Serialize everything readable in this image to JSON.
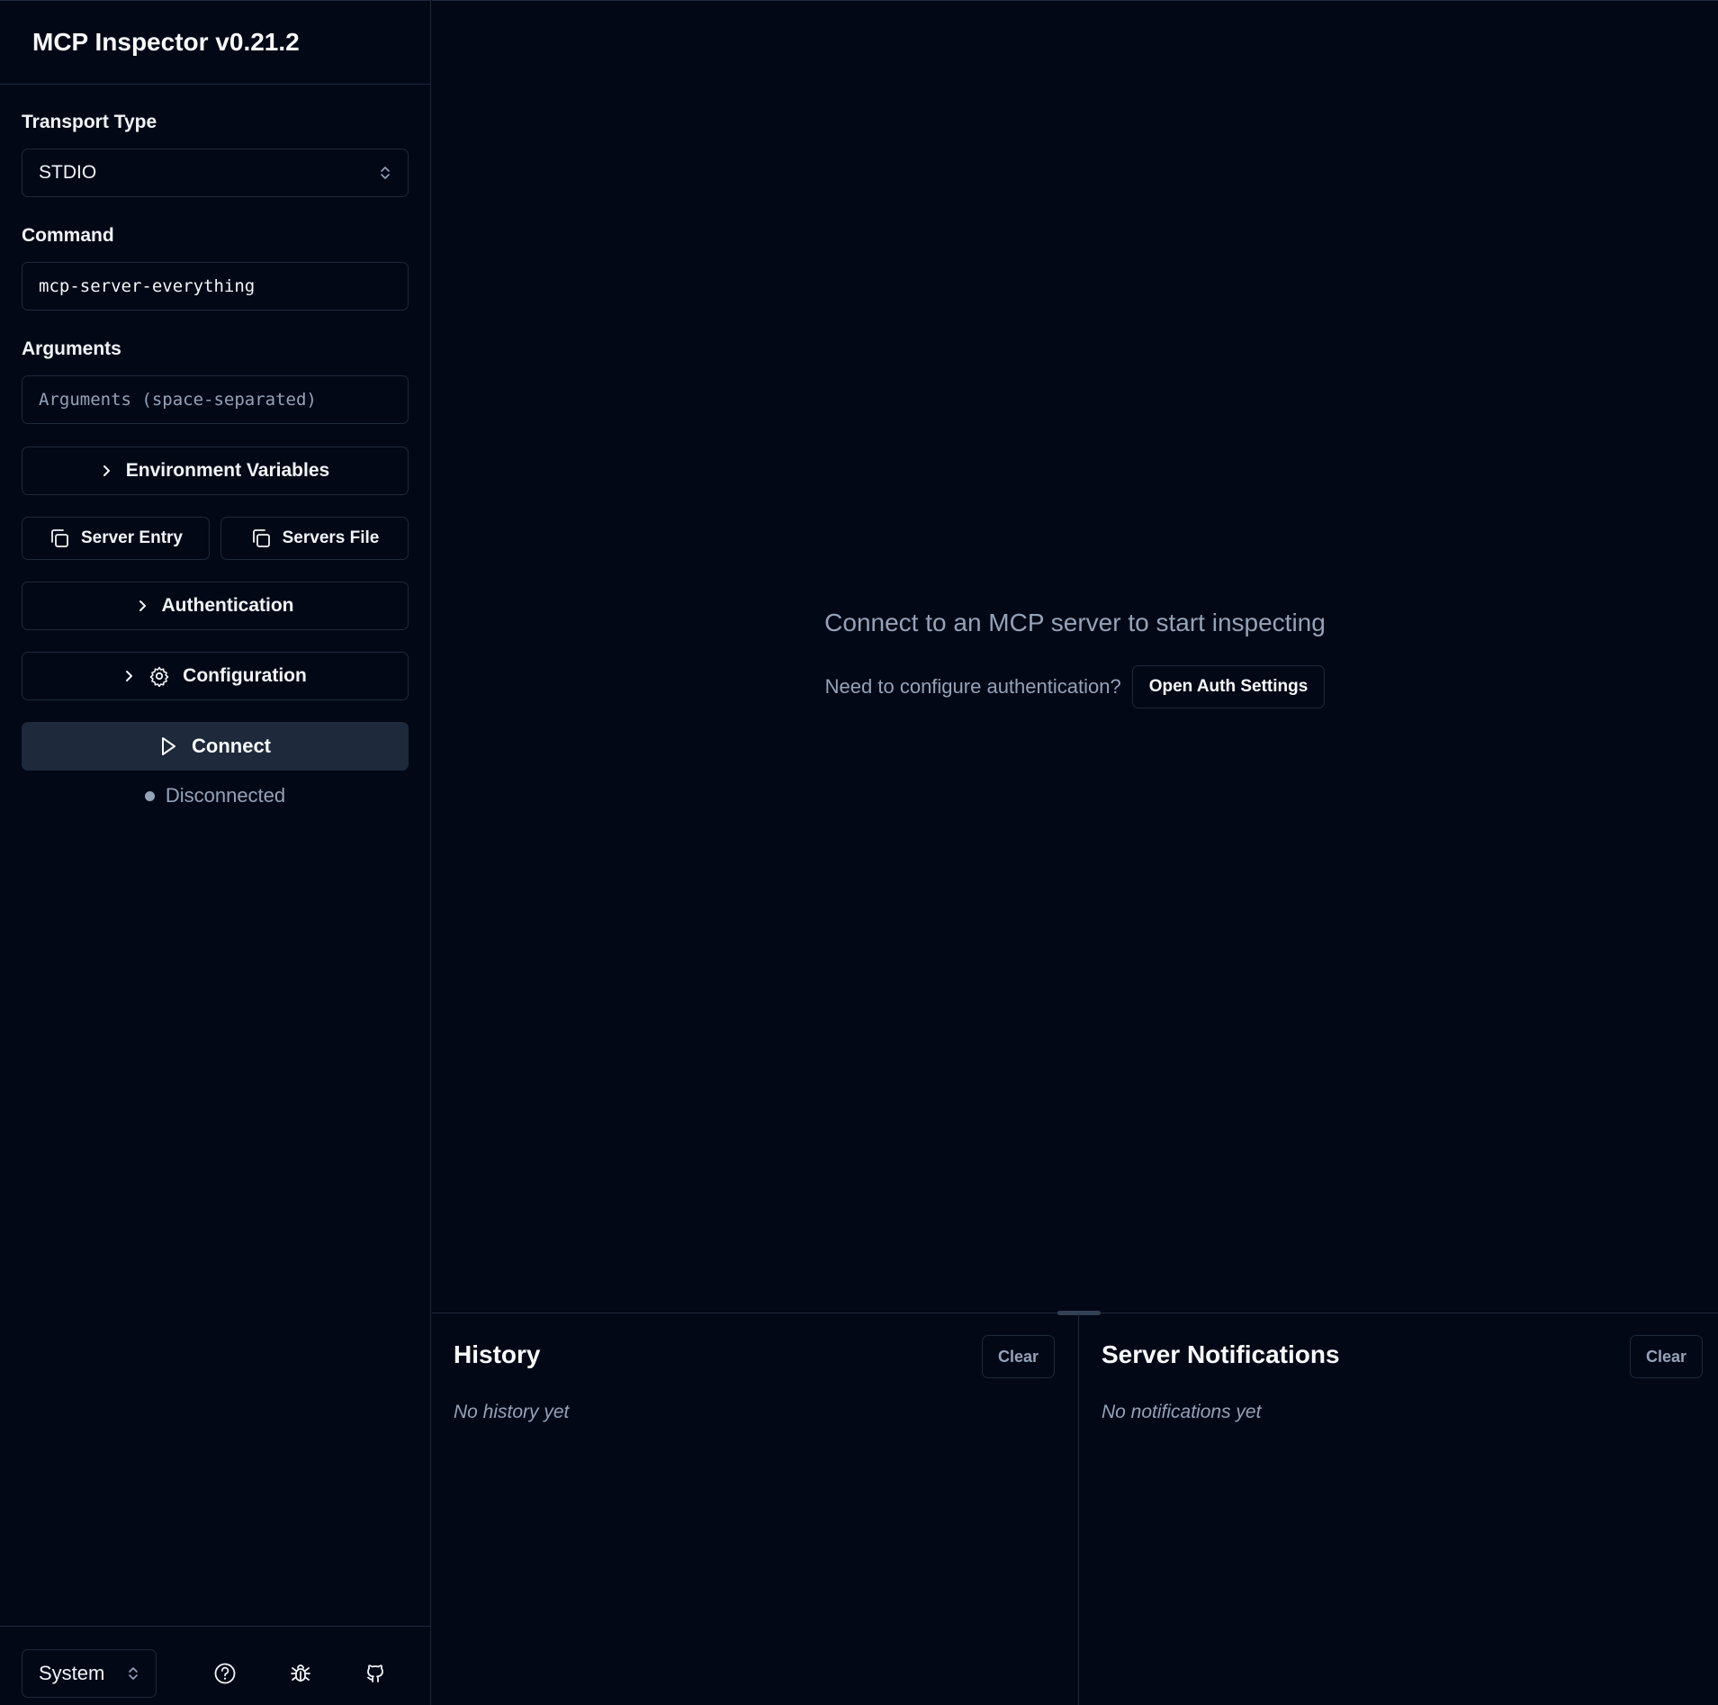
{
  "sidebar": {
    "title": "MCP Inspector v0.21.2",
    "transport": {
      "label": "Transport Type",
      "value": "STDIO"
    },
    "command": {
      "label": "Command",
      "value": "mcp-server-everything"
    },
    "arguments": {
      "label": "Arguments",
      "placeholder": "Arguments (space-separated)"
    },
    "env_vars_label": "Environment Variables",
    "server_entry_label": "Server Entry",
    "servers_file_label": "Servers File",
    "authentication_label": "Authentication",
    "configuration_label": "Configuration",
    "connect_label": "Connect",
    "status_text": "Disconnected"
  },
  "footer": {
    "theme_value": "System"
  },
  "main": {
    "empty_title": "Connect to an MCP server to start inspecting",
    "auth_prompt": "Need to configure authentication?",
    "auth_button": "Open Auth Settings"
  },
  "history": {
    "title": "History",
    "clear_label": "Clear",
    "empty_text": "No history yet"
  },
  "notifications": {
    "title": "Server Notifications",
    "clear_label": "Clear",
    "empty_text": "No notifications yet"
  },
  "colors": {
    "background": "#030816",
    "border": "#1e293b",
    "muted": "#94a3b8",
    "button_bg": "#1e293b"
  },
  "icons": [
    "chevron-up-down-icon",
    "chevron-right-icon",
    "copy-icon",
    "gear-icon",
    "play-icon",
    "help-circle-icon",
    "bug-icon",
    "github-icon"
  ]
}
